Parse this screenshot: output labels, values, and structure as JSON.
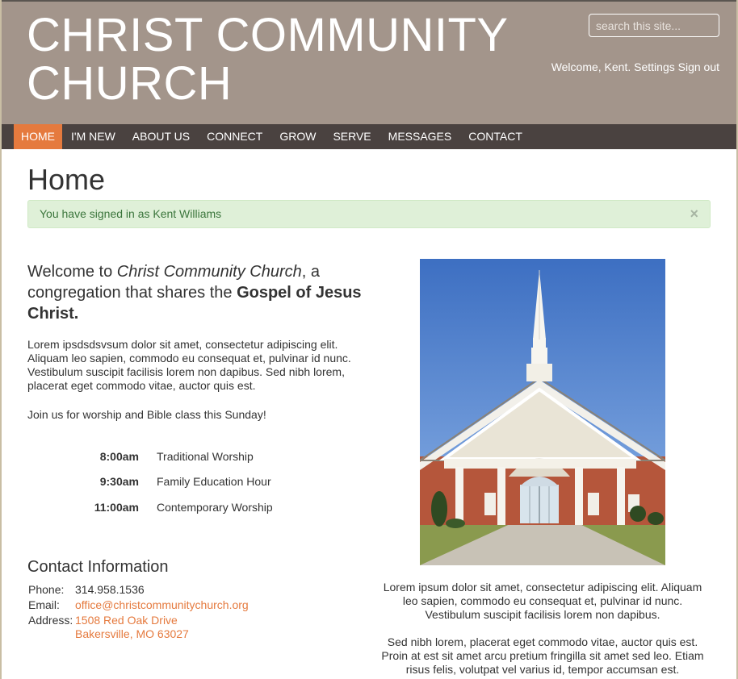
{
  "header": {
    "title_line1": "CHRIST COMMUNITY",
    "title_line2": "CHURCH",
    "search_placeholder": "search this site...",
    "welcome": "Welcome, Kent.",
    "settings": "Settings",
    "signout": "Sign out"
  },
  "nav": {
    "items": [
      "HOME",
      "I'M NEW",
      "ABOUT US",
      "CONNECT",
      "GROW",
      "SERVE",
      "MESSAGES",
      "CONTACT"
    ],
    "active": "HOME"
  },
  "page": {
    "title": "Home",
    "alert": "You have signed in as Kent Williams",
    "alert_close": "×"
  },
  "welcome": {
    "prefix": "Welcome to ",
    "church_name": "Christ Community Church",
    "middle": ", a congregation that shares the ",
    "gospel": "Gospel of Jesus Christ."
  },
  "intro": {
    "paragraph": "Lorem ipsdsdsvsum dolor sit amet, consectetur adipiscing elit. Aliquam leo sapien, commodo eu consequat et, pulvinar id nunc. Vestibulum suscipit facilisis lorem non dapibus. Sed nibh lorem, placerat eget commodo vitae, auctor quis est.",
    "worship_invite": "Join us for worship and Bible class this Sunday!"
  },
  "services": [
    {
      "time": "8:00am",
      "name": "Traditional Worship"
    },
    {
      "time": "9:30am",
      "name": "Family Education Hour"
    },
    {
      "time": "11:00am",
      "name": "Contemporary Worship"
    }
  ],
  "contact": {
    "title": "Contact Information",
    "phone_label": "Phone:",
    "phone": "314.958.1536",
    "email_label": "Email:",
    "email": "office@christcommunitychurch.org",
    "address_label": "Address:",
    "address_line1": "1508 Red Oak Drive",
    "address_line2": "Bakersville, MO 63027"
  },
  "caption": {
    "p1": "Lorem ipsum dolor sit amet, consectetur adipiscing elit. Aliquam leo sapien, commodo eu consequat et, pulvinar id nunc. Vestibulum suscipit facilisis lorem non dapibus.",
    "p2": "Sed nibh lorem, placerat eget commodo vitae, auctor quis est. Proin at est sit amet arcu pretium fringilla sit amet sed leo. Etiam risus felis, volutpat vel varius id, tempor accumsan est."
  },
  "colors": {
    "header_bg": "#a3958b",
    "nav_bg": "#4a4240",
    "accent": "#e57a3e",
    "alert_bg": "#dff0d8",
    "alert_text": "#3c763d"
  }
}
